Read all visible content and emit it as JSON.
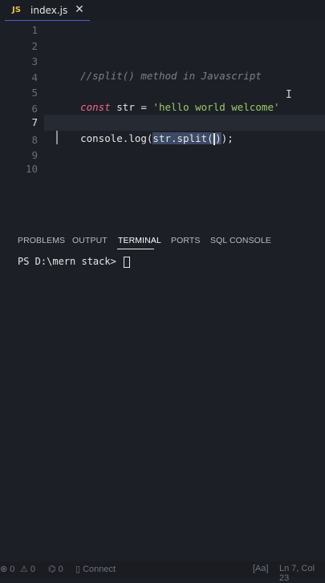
{
  "tab": {
    "badge": "JS",
    "filename": "index.js",
    "close_glyph": "✕"
  },
  "editor": {
    "line_numbers": [
      "1",
      "2",
      "3",
      "4",
      "5",
      "6",
      "7",
      "8",
      "9",
      "10"
    ],
    "active_line": "7",
    "line3_comment": "//split() method in Javascript",
    "line5": {
      "keyword": "const",
      "name": " str ",
      "equals": "= ",
      "string": "'hello world welcome'"
    },
    "line7": {
      "prefix": "console.log(",
      "selected_before_cursor": "str.split(",
      "selected_after_cursor": ")",
      "suffix": ");"
    }
  },
  "panel": {
    "tabs": [
      "PROBLEMS",
      "OUTPUT",
      "TERMINAL",
      "PORTS",
      "SQL CONSOLE"
    ],
    "active_tab": "TERMINAL"
  },
  "terminal": {
    "prompt": "PS D:\\mern stack> "
  },
  "statusbar": {
    "errors": "0",
    "warnings": "0",
    "ports": "0",
    "connect": "Connect",
    "match_case": "[Aa]",
    "position": "Ln 7, Col 23"
  },
  "colors": {
    "background": "#1c1f26",
    "keyword": "#f6648a",
    "string": "#9ccc65",
    "comment": "#7a808c",
    "js_badge": "#e5c34f",
    "selection": "#3d4a66"
  }
}
